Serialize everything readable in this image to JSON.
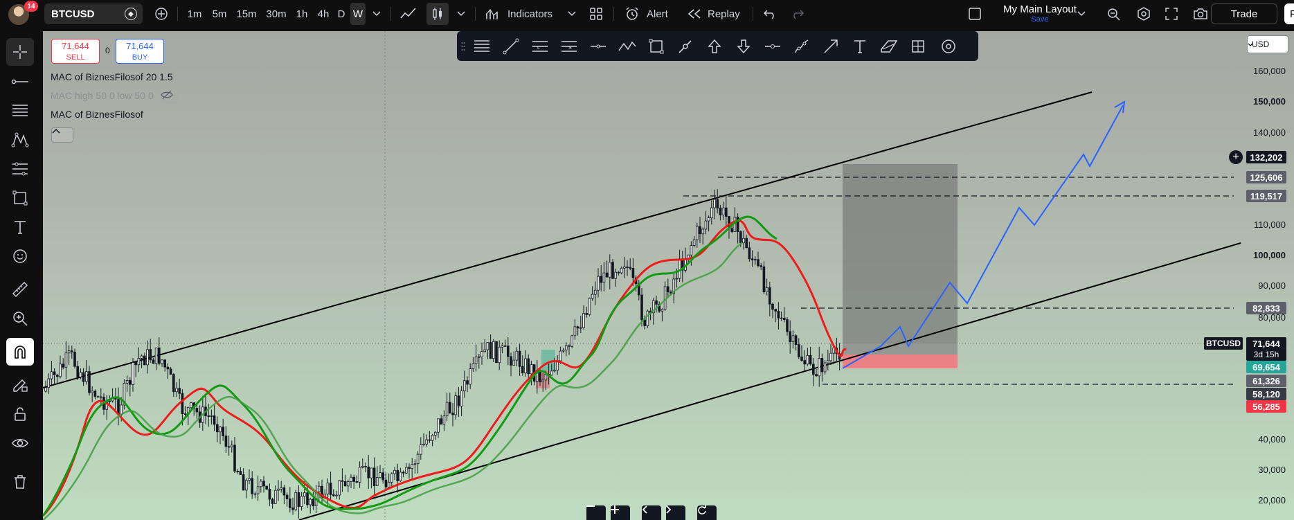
{
  "topbar": {
    "notification_count": "14",
    "symbol": "BTCUSD",
    "timeframes": [
      "1m",
      "5m",
      "15m",
      "30m",
      "1h",
      "4h",
      "D",
      "W"
    ],
    "active_timeframe": "W",
    "indicators_label": "Indicators",
    "alert_label": "Alert",
    "replay_label": "Replay",
    "layout_name": "My Main Layout",
    "layout_save": "Save",
    "trade_label": "Trade",
    "publish_label": "Pu"
  },
  "legend": {
    "sell_price": "71,644",
    "sell_label": "SELL",
    "spread": "0",
    "buy_price": "71,644",
    "buy_label": "BUY",
    "line1": "MAC of BiznesFilosof 20 1.5",
    "line2": "MAC high 50 0 low 50 0",
    "line3": "MAC of BiznesFilosof"
  },
  "currency": "USD",
  "price_scale": {
    "ticks": [
      "160,000",
      "150,000",
      "140,000",
      "110,000",
      "100,000",
      "90,000",
      "80,000",
      "40,000",
      "30,000",
      "20,000"
    ],
    "tags": {
      "crosshair": "132,202",
      "lvl1": "125,606",
      "lvl2": "119,517",
      "lvl3": "82,833",
      "symbol": "BTCUSD",
      "last_price": "71,644",
      "countdown": "3d 15h",
      "green_tag": "69,654",
      "grey_tag1": "61,326",
      "grey_tag2": "58,120",
      "red_tag": "56,285"
    }
  },
  "colors": {
    "accent_blue": "#2962ff",
    "sell_red": "#f23645",
    "ma_red": "#ee1b1b",
    "ma_green": "#119911",
    "projection_blue": "#2962ff"
  },
  "chart_data": {
    "type": "candlestick",
    "symbol": "BTCUSD",
    "ylim": [
      15000,
      170000
    ]
  }
}
